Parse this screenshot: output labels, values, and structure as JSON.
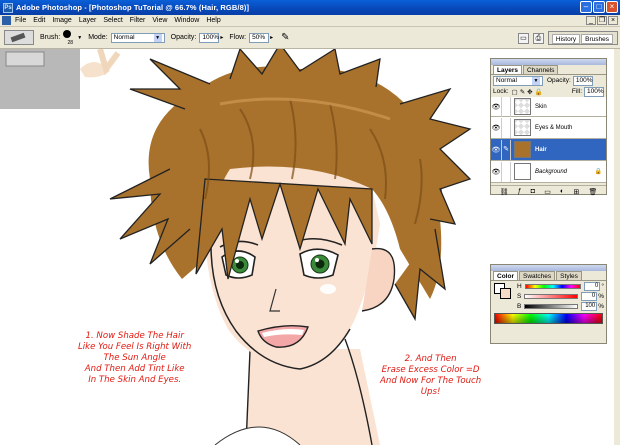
{
  "window": {
    "title": "Adobe Photoshop - [Photoshop TuTorial @ 66.7% (Hair, RGB/8)]"
  },
  "menu": [
    "File",
    "Edit",
    "Image",
    "Layer",
    "Select",
    "Filter",
    "View",
    "Window",
    "Help"
  ],
  "options": {
    "brush_label": "Brush:",
    "brush_size": "28",
    "mode_label": "Mode:",
    "mode_value": "Normal",
    "opacity_label": "Opacity:",
    "opacity_value": "100%",
    "flow_label": "Flow:",
    "flow_value": "50%"
  },
  "palette_well": {
    "tabs": [
      "History",
      "Brushes"
    ]
  },
  "layers_panel": {
    "tabs": [
      "Layers",
      "Channels"
    ],
    "blend_mode": "Normal",
    "opacity_label": "Opacity:",
    "opacity_value": "100%",
    "lock_label": "Lock:",
    "fill_label": "Fill:",
    "fill_value": "100%",
    "layers": [
      {
        "name": "Skin",
        "thumb": "checker",
        "active": false
      },
      {
        "name": "Eyes & Mouth",
        "thumb": "checker",
        "active": false
      },
      {
        "name": "Hair",
        "thumb": "hair",
        "active": true
      },
      {
        "name": "Background",
        "thumb": "bg",
        "active": false
      }
    ]
  },
  "color_panel": {
    "tabs": [
      "Color",
      "Swatches",
      "Styles"
    ],
    "channels": [
      {
        "label": "H",
        "value": "0"
      },
      {
        "label": "S",
        "value": "0"
      },
      {
        "label": "B",
        "value": "100"
      }
    ],
    "percent": "%",
    "degree": "°",
    "foreground": "#ffffff",
    "background": "#f4dcc6"
  },
  "captions": {
    "left": [
      "1. Now  Shade The Hair",
      "Like You Feel Is Right With",
      "The Sun Angle",
      "And Then Add Tint Like",
      "In The Skin And Eyes."
    ],
    "right": [
      "2. And Then",
      "Erase Excess Color =D",
      "And Now For The Touch",
      "Ups!"
    ]
  },
  "colors": {
    "caption_red": "#e01a12",
    "hair": "#a8722c",
    "skin": "#fbe3d3"
  }
}
